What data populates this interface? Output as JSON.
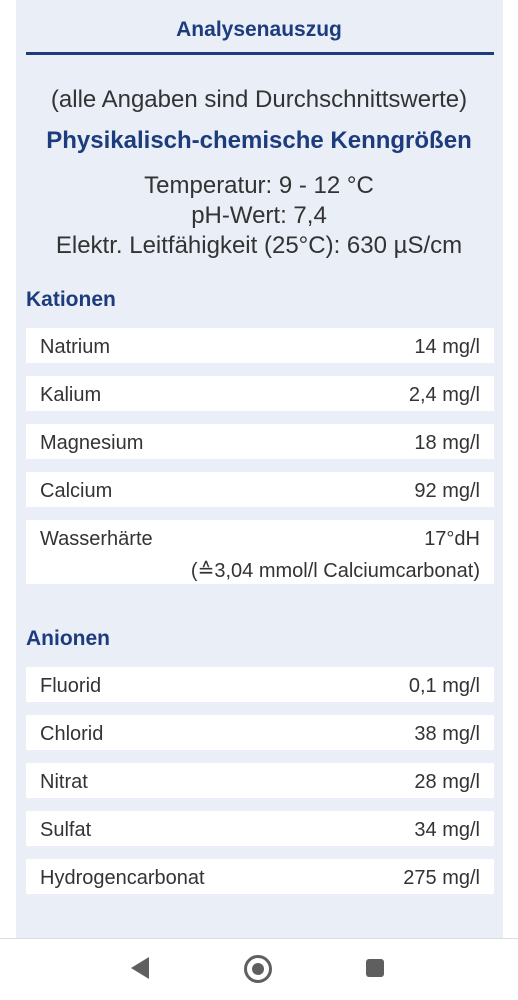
{
  "header": {
    "title": "Analysenauszug"
  },
  "intro": {
    "note": "(alle Angaben sind Durchschnittswerte)",
    "subheading": "Physikalisch-chemische Kenngrößen",
    "temperature": "Temperatur: 9 - 12 °C",
    "ph": "pH-Wert: 7,4",
    "conductivity": "Elektr. Leitfähigkeit (25°C): 630 µS/cm"
  },
  "kationen": {
    "heading": "Kationen",
    "rows": [
      {
        "label": "Natrium",
        "value": "14 mg/l"
      },
      {
        "label": "Kalium",
        "value": "2,4 mg/l"
      },
      {
        "label": "Magnesium",
        "value": "18 mg/l"
      },
      {
        "label": "Calcium",
        "value": "92 mg/l"
      },
      {
        "label": "Wasserhärte",
        "value": "17°dH",
        "note": "(≙3,04 mmol/l Calciumcarbonat)"
      }
    ]
  },
  "anionen": {
    "heading": "Anionen",
    "rows": [
      {
        "label": "Fluorid",
        "value": "0,1 mg/l"
      },
      {
        "label": "Chlorid",
        "value": "38 mg/l"
      },
      {
        "label": "Nitrat",
        "value": "28 mg/l"
      },
      {
        "label": "Sulfat",
        "value": "34 mg/l"
      },
      {
        "label": "Hydrogencarbonat",
        "value": "275 mg/l"
      }
    ]
  },
  "navbar": {
    "back_icon": "back-triangle-icon",
    "home_icon": "home-circle-icon",
    "recent_icon": "recent-apps-square-icon"
  }
}
